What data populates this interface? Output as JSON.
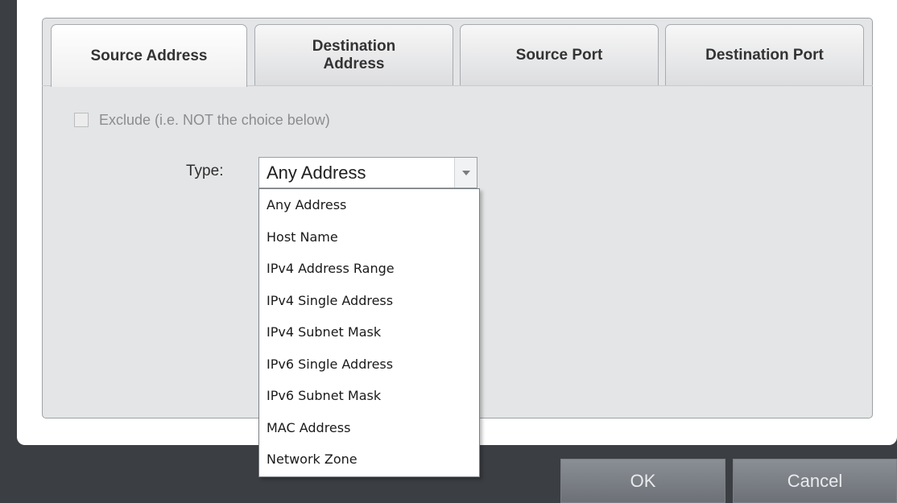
{
  "tabs": [
    {
      "label": "Source Address",
      "active": true
    },
    {
      "label": "Destination\nAddress",
      "active": false
    },
    {
      "label": "Source Port",
      "active": false
    },
    {
      "label": "Destination Port",
      "active": false
    }
  ],
  "exclude": {
    "label": "Exclude (i.e. NOT the choice below)",
    "checked": false
  },
  "type": {
    "label": "Type:",
    "selected": "Any Address",
    "options": [
      "Any Address",
      "Host Name",
      "IPv4 Address Range",
      "IPv4 Single Address",
      "IPv4 Subnet Mask",
      "IPv6 Single Address",
      "IPv6 Subnet Mask",
      "MAC Address",
      "Network Zone"
    ]
  },
  "buttons": {
    "ok": "OK",
    "cancel": "Cancel"
  },
  "colors": {
    "frame": "#3b3e42",
    "panel": "#e4e5e6",
    "button": "#7d8187"
  }
}
